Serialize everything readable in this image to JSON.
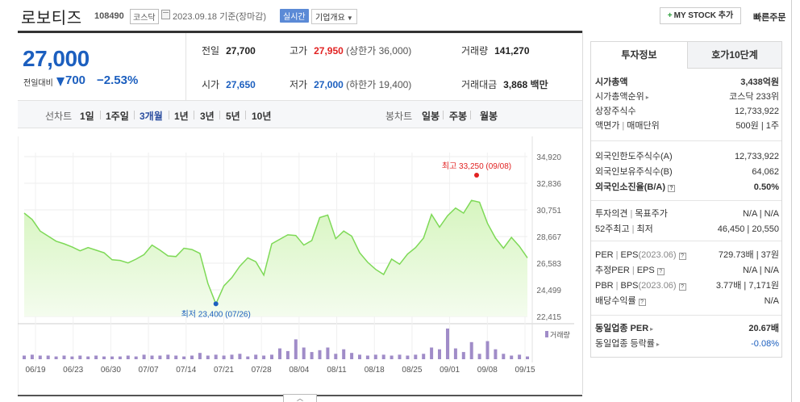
{
  "header": {
    "name": "로보티즈",
    "code": "108490",
    "market": "코스닥",
    "date": "2023.09.18 기준(장마감)",
    "realtime": "실시간",
    "company_info": "기업개요",
    "my_stock": "MY STOCK 추가",
    "quick_order": "빠른주문"
  },
  "price": {
    "current": "27,000",
    "change_label": "전일대비",
    "change": "700",
    "change_pct": "−2.53%"
  },
  "stats": {
    "prev_label": "전일",
    "prev": "27,700",
    "high_label": "고가",
    "high": "27,950",
    "upper_limit": "(상한가 36,000)",
    "volume_label": "거래량",
    "volume": "141,270",
    "open_label": "시가",
    "open": "27,650",
    "low_label": "저가",
    "low": "27,000",
    "lower_limit": "(하한가 19,400)",
    "amount_label": "거래대금",
    "amount": "3,868",
    "amount_unit": "백만"
  },
  "period": {
    "line_label": "선차트",
    "line_tabs": [
      "1일",
      "1주일",
      "3개월",
      "1년",
      "3년",
      "5년",
      "10년"
    ],
    "active": "3개월",
    "candle_label": "봉차트",
    "candle_tabs": [
      "일봉",
      "주봉",
      "월봉"
    ]
  },
  "chart_data": {
    "type": "area",
    "x_ticks": [
      "06/19",
      "06/23",
      "06/30",
      "07/07",
      "07/14",
      "07/21",
      "07/28",
      "08/04",
      "08/11",
      "08/18",
      "08/25",
      "09/01",
      "09/08",
      "09/15"
    ],
    "y_ticks": [
      "34,920",
      "32,836",
      "30,751",
      "28,667",
      "26,583",
      "24,499",
      "22,415"
    ],
    "ylim": [
      22415,
      34920
    ],
    "prices": [
      30500,
      30000,
      29100,
      28700,
      28300,
      28100,
      27850,
      27550,
      27800,
      27600,
      27400,
      26850,
      26800,
      26600,
      26900,
      27250,
      28000,
      27600,
      27150,
      27100,
      27750,
      27650,
      27350,
      25000,
      23400,
      24800,
      25450,
      26350,
      27000,
      26700,
      25650,
      28100,
      28450,
      28800,
      28750,
      28000,
      28350,
      30150,
      30350,
      28500,
      29100,
      28700,
      27400,
      26650,
      26100,
      25700,
      26900,
      26500,
      27300,
      27800,
      28550,
      30400,
      29400,
      30300,
      30900,
      30500,
      31500,
      31350,
      29700,
      28550,
      27750,
      28600,
      27900,
      27000
    ],
    "volumes": [
      4,
      5,
      4,
      4,
      3,
      4,
      3,
      4,
      3,
      4,
      3,
      3,
      3,
      4,
      3,
      5,
      4,
      4,
      5,
      4,
      3,
      4,
      7,
      4,
      5,
      4,
      5,
      6,
      3,
      5,
      4,
      5,
      12,
      9,
      22,
      13,
      8,
      10,
      13,
      6,
      11,
      7,
      5,
      4,
      5,
      5,
      4,
      5,
      4,
      5,
      6,
      13,
      11,
      34,
      12,
      8,
      19,
      6,
      20,
      11,
      6,
      4,
      5,
      3
    ],
    "max_label": "최고 33,250 (09/08)",
    "min_label": "최저 23,400 (07/26)",
    "volume_legend": "거래량",
    "line_color": "#7ed957",
    "fill_color": "#e9f9dc",
    "volume_color": "#a08cc8"
  },
  "panel": {
    "tab_invest": "투자정보",
    "tab_hoga": "호가10단계",
    "market_cap_label": "시가총액",
    "market_cap": "3,438억원",
    "cap_rank_label": "시가총액순위",
    "cap_rank": "코스닥 233위",
    "shares_label": "상장주식수",
    "shares": "12,733,922",
    "par_label": "액면가",
    "unit_label": "매매단위",
    "par_unit": "500원 | 1주",
    "foreign_limit_label": "외국인한도주식수(A)",
    "foreign_limit": "12,733,922",
    "foreign_hold_label": "외국인보유주식수(B)",
    "foreign_hold": "64,062",
    "foreign_ratio_label": "외국인소진율(B/A)",
    "foreign_ratio": "0.50%",
    "opinion_label": "투자의견",
    "target_label": "목표주가",
    "opinion_target": "N/A | N/A",
    "w52_high_label": "52주최고",
    "w52_low_label": "최저",
    "w52": "46,450 | 20,550",
    "per_label": "PER",
    "eps_label": "EPS",
    "year": "(2023.06)",
    "per_eps": "729.73배 | 37원",
    "est_per_label": "추정PER",
    "est_eps_label": "EPS",
    "est": "N/A | N/A",
    "pbr_label": "PBR",
    "bps_label": "BPS",
    "pbr_bps": "3.77배 | 7,171원",
    "div_label": "배당수익률",
    "div": "N/A",
    "sector_per_label": "동일업종 PER",
    "sector_per": "20.67배",
    "sector_chg_label": "동일업종 등락률",
    "sector_chg": "-0.08%"
  }
}
